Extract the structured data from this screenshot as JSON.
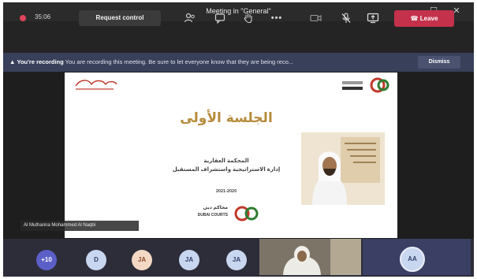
{
  "window": {
    "title": "Meeting in \"General\"",
    "controls": {
      "minimize": "–",
      "maximize": "☐",
      "close": "✕"
    }
  },
  "toolbar": {
    "timer": "35:06",
    "request_control_label": "Request control",
    "icons": [
      "participants-icon",
      "chat-icon",
      "raise-hand-icon",
      "more-options-icon",
      "camera-off-icon",
      "mic-off-icon",
      "share-screen-icon"
    ],
    "more_label": "•••",
    "leave_label": "Leave",
    "leave_color": "#c4314b"
  },
  "banner": {
    "strong": "You're recording",
    "message": "You are recording this meeting. Be sure to let everyone know that they are being reco...",
    "dismiss_label": "Dismiss"
  },
  "slide": {
    "heading": "الجلسة الأولى",
    "line1": "المحكمة العقارية",
    "line2": "إدارة الاستراتيجية واستشراف المستقبل",
    "date": "2021-2020",
    "logo_text": "DUBAI COURTS",
    "logo_arabic": "محاكم دبي",
    "heading_color": "#b68b3b"
  },
  "presenter": {
    "name": "Al Muthanna Mohammed Al Naqbi"
  },
  "participants": [
    {
      "initials": "+10"
    },
    {
      "initials": "D"
    },
    {
      "initials": "JA"
    },
    {
      "initials": "JA"
    },
    {
      "initials": "JA"
    }
  ],
  "self": {
    "initials": "AA"
  }
}
